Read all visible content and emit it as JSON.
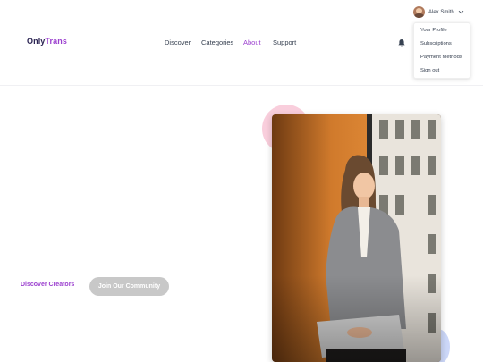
{
  "brand": {
    "part1": "Only",
    "part2": "Trans"
  },
  "nav": {
    "items": [
      {
        "label": "Discover"
      },
      {
        "label": "Categories"
      },
      {
        "label": "About"
      },
      {
        "label": "Support"
      }
    ],
    "active": "About"
  },
  "user": {
    "name": "Alex Smith"
  },
  "user_menu": {
    "items": [
      {
        "label": "Your Profile"
      },
      {
        "label": "Subscriptions"
      },
      {
        "label": "Payment Methods"
      },
      {
        "label": "Sign out"
      }
    ]
  },
  "hero": {
    "primary_cta": "Discover Creators",
    "secondary_cta": "Join Our Community"
  },
  "colors": {
    "brand_purple": "#9b3fcf",
    "brand_dark": "#2a2352",
    "secondary_button": "#c8c8c8",
    "blob_pink": "#f8c6d6",
    "blob_blue": "#c7d3f7"
  },
  "icons": {
    "notifications": "bell-icon",
    "user_menu_toggle": "chevron-down-icon"
  }
}
